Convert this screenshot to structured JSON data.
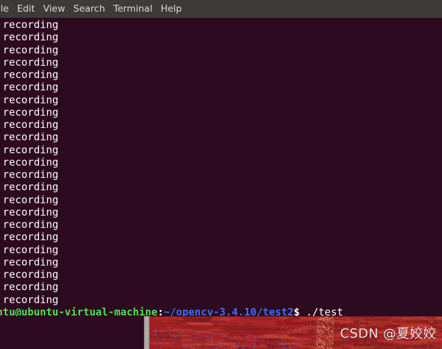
{
  "window": {
    "title": "Terminal",
    "background_color": "#2c0a20",
    "menubar_color": "#3c3b37"
  },
  "menubar": {
    "items": [
      {
        "label": "ile",
        "name": "menu-file",
        "clipped": true
      },
      {
        "label": "Edit",
        "name": "menu-edit",
        "clipped": false
      },
      {
        "label": "View",
        "name": "menu-view",
        "clipped": false
      },
      {
        "label": "Search",
        "name": "menu-search",
        "clipped": false
      },
      {
        "label": "Terminal",
        "name": "menu-terminal",
        "clipped": false
      },
      {
        "label": "Help",
        "name": "menu-help",
        "clipped": false
      }
    ]
  },
  "terminal": {
    "output_line_text": "d recording",
    "output_line_count": 23,
    "output_lines": [
      "d recording",
      "d recording",
      "d recording",
      "d recording",
      "d recording",
      "d recording",
      "d recording",
      "d recording",
      "d recording",
      "d recording",
      "d recording",
      "d recording",
      "d recording",
      "d recording",
      "d recording",
      "d recording",
      "d recording",
      "d recording",
      "d recording",
      "d recording",
      "d recording",
      "d recording",
      "d recording"
    ],
    "prompt": {
      "user_host": "untu@ubuntu-virtual-machine",
      "separator": ":",
      "path": "~/opencv-3.4.10/test2",
      "sigil": "$",
      "command": " ./test",
      "user_color": "#4ee24e",
      "path_color": "#3b6ff5",
      "text_color": "#ffffff"
    }
  },
  "image_window": {
    "name": "opencv-display-window",
    "base_color": "#a32222",
    "speckle_color": "#4a6fd4",
    "watermark": "CSDN @夏姣姣"
  }
}
